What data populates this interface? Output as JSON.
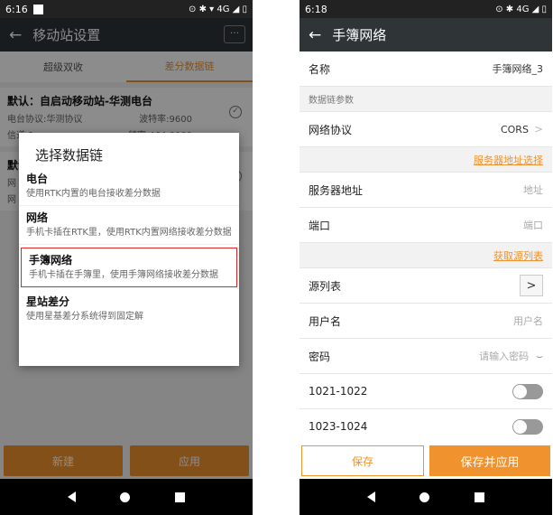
{
  "left": {
    "status": {
      "time": "6:16",
      "icons": "⊙ ✱ ▾ 4G ◢ ▯"
    },
    "appbar": {
      "back": "←",
      "title": "移动站设置",
      "more": "···"
    },
    "tabs": [
      "超级双收",
      "差分数据链"
    ],
    "cards": [
      {
        "title": "默认：自启动移动站-华测电台",
        "line1a": "电台协议:华测协议",
        "line1b": "波特率:9600",
        "line2a": "信道:1",
        "line2b": "频率:464.0000"
      },
      {
        "title": "默认",
        "line1a": "网",
        "line1b": "",
        "line2a": "网",
        "line2b": ""
      }
    ],
    "buttons": {
      "new": "新建",
      "apply": "应用"
    },
    "dialog": {
      "title": "选择数据链",
      "options": [
        {
          "title": "电台",
          "desc": "使用RTK内置的电台接收差分数据"
        },
        {
          "title": "网络",
          "desc": "手机卡插在RTK里，使用RTK内置网络接收差分数据"
        },
        {
          "title": "手簿网络",
          "desc": "手机卡插在手簿里，使用手簿网络接收差分数据"
        },
        {
          "title": "星站差分",
          "desc": "使用星基差分系统得到固定解"
        }
      ]
    }
  },
  "right": {
    "status": {
      "time": "6:18",
      "icons": "⊙ ✱ 4G ◢ ▯"
    },
    "appbar": {
      "back": "←",
      "title": "手簿网络"
    },
    "name": {
      "label": "名称",
      "value": "手簿网络_3"
    },
    "section_label": "数据链参数",
    "protocol": {
      "label": "网络协议",
      "value": "CORS",
      "chevron": ">"
    },
    "server_link": "服务器地址选择",
    "server": {
      "label": "服务器地址",
      "placeholder": "地址"
    },
    "port": {
      "label": "端口",
      "placeholder": "端口"
    },
    "source_link": "获取源列表",
    "source": {
      "label": "源列表",
      "button": ">"
    },
    "username": {
      "label": "用户名",
      "placeholder": "用户名"
    },
    "password": {
      "label": "密码",
      "placeholder": "请输入密码",
      "eye": "⌣"
    },
    "toggle1": {
      "label": "1021-1022",
      "on": false
    },
    "toggle2": {
      "label": "1023-1024",
      "on": false
    },
    "save": "保存",
    "save_apply": "保存并应用"
  }
}
